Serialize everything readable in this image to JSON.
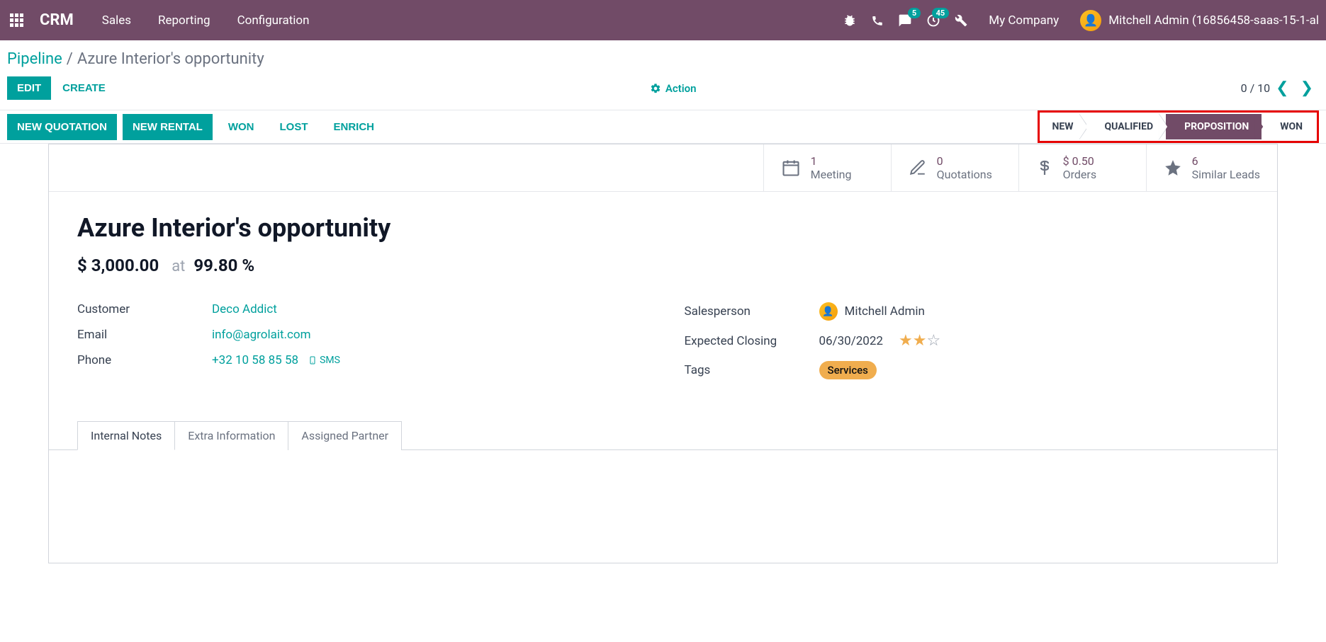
{
  "topnav": {
    "brand": "CRM",
    "menu": [
      "Sales",
      "Reporting",
      "Configuration"
    ],
    "msg_badge": "5",
    "activity_badge": "45",
    "company": "My Company",
    "user": "Mitchell Admin (16856458-saas-15-1-al"
  },
  "breadcrumb": {
    "root": "Pipeline",
    "current": "Azure Interior's opportunity"
  },
  "actions": {
    "edit": "EDIT",
    "create": "CREATE",
    "action": "Action",
    "pager": "0 / 10"
  },
  "toolbar": {
    "new_quotation": "NEW QUOTATION",
    "new_rental": "NEW RENTAL",
    "won": "WON",
    "lost": "LOST",
    "enrich": "ENRICH"
  },
  "status": {
    "steps": [
      "NEW",
      "QUALIFIED",
      "PROPOSITION",
      "WON"
    ],
    "active_index": 2
  },
  "stats": {
    "meeting": {
      "num": "1",
      "label": "Meeting"
    },
    "quotations": {
      "num": "0",
      "label": "Quotations"
    },
    "orders": {
      "num": "$ 0.50",
      "label": "Orders"
    },
    "similar": {
      "num": "6",
      "label": "Similar Leads"
    }
  },
  "record": {
    "title": "Azure Interior's opportunity",
    "amount": "$ 3,000.00",
    "at_label": "at",
    "probability": "99.80 %",
    "labels": {
      "customer": "Customer",
      "email": "Email",
      "phone": "Phone",
      "salesperson": "Salesperson",
      "expected_closing": "Expected Closing",
      "tags": "Tags",
      "sms": "SMS"
    },
    "customer": "Deco Addict",
    "email": "info@agrolait.com",
    "phone": "+32 10 58 85 58",
    "salesperson": "Mitchell Admin",
    "expected_closing": "06/30/2022",
    "tag": "Services"
  },
  "tabs": [
    "Internal Notes",
    "Extra Information",
    "Assigned Partner"
  ]
}
